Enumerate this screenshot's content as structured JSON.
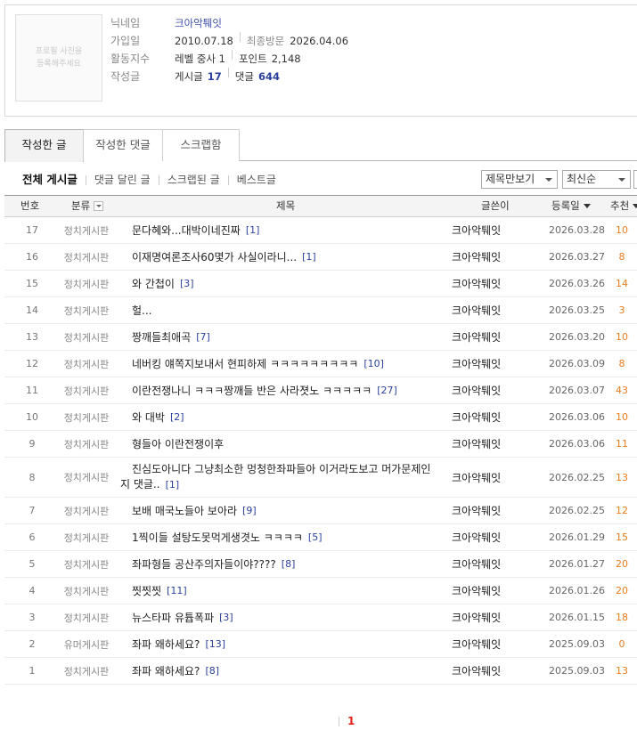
{
  "profile": {
    "photo_placeholder": "프로필 사진을\n등록해주세요",
    "nickname_label": "닉네임",
    "nickname": "크아악퉤잇",
    "joined_label": "가입일",
    "joined": "2010.07.18",
    "last_visit_label": "최종방문",
    "last_visit": "2026.04.06",
    "activity_label": "활동지수",
    "level": "레벨 중사 1",
    "point_label": "포인트",
    "point": "2,148",
    "posts_label": "작성글",
    "post_count_label": "게시글",
    "post_count": "17",
    "comment_count_label": "댓글",
    "comment_count": "644"
  },
  "tabs": [
    "작성한 글",
    "작성한 댓글",
    "스크랩함"
  ],
  "filters": [
    "전체 게시글",
    "댓글 달린 글",
    "스크랩된 글",
    "베스트글"
  ],
  "view_select": "제목만보기",
  "sort_select": "최신순",
  "table": {
    "headers": {
      "num": "번호",
      "cat": "분류",
      "title": "제목",
      "author": "글쓴이",
      "date": "등록일",
      "rec": "추천"
    },
    "rows": [
      {
        "num": "17",
        "cat": "정치게시판",
        "title": "문다혜와...대박이네진짜",
        "cc": "[1]",
        "author": "크아악퉤잇",
        "date": "2026.03.28",
        "rec": "10"
      },
      {
        "num": "16",
        "cat": "정치게시판",
        "title": "이재명여론조사60몇가 사실이라니...",
        "cc": "[1]",
        "author": "크아악퉤잇",
        "date": "2026.03.27",
        "rec": "8"
      },
      {
        "num": "15",
        "cat": "정치게시판",
        "title": "와 간첩이",
        "cc": "[3]",
        "author": "크아악퉤잇",
        "date": "2026.03.26",
        "rec": "14"
      },
      {
        "num": "14",
        "cat": "정치게시판",
        "title": "헐...",
        "cc": "",
        "author": "크아악퉤잇",
        "date": "2026.03.25",
        "rec": "3"
      },
      {
        "num": "13",
        "cat": "정치게시판",
        "title": "짱깨들최애곡",
        "cc": "[7]",
        "author": "크아악퉤잇",
        "date": "2026.03.20",
        "rec": "10"
      },
      {
        "num": "12",
        "cat": "정치게시판",
        "title": "네버킹 얘쪽지보내서 현피하제 ㅋㅋㅋㅋㅋㅋㅋㅋㅋ",
        "cc": "[10]",
        "author": "크아악퉤잇",
        "date": "2026.03.09",
        "rec": "8"
      },
      {
        "num": "11",
        "cat": "정치게시판",
        "title": "이란전쟁나니 ㅋㅋㅋ짱깨들 반은 사라졋노 ㅋㅋㅋㅋㅋ",
        "cc": "[27]",
        "author": "크아악퉤잇",
        "date": "2026.03.07",
        "rec": "43"
      },
      {
        "num": "10",
        "cat": "정치게시판",
        "title": "와 대박",
        "cc": "[2]",
        "author": "크아악퉤잇",
        "date": "2026.03.06",
        "rec": "10"
      },
      {
        "num": "9",
        "cat": "정치게시판",
        "title": "형들아 이란전쟁이후",
        "cc": "",
        "author": "크아악퉤잇",
        "date": "2026.03.06",
        "rec": "11"
      },
      {
        "num": "8",
        "cat": "정치게시판",
        "title": "진심도아니다 그냥최소한 멍청한좌파들아 이거라도보고 머가문제인지 댓글..",
        "cc": "[1]",
        "author": "크아악퉤잇",
        "date": "2026.02.25",
        "rec": "13",
        "tall": true
      },
      {
        "num": "7",
        "cat": "정치게시판",
        "title": "보배 매국노들아 보아라",
        "cc": "[9]",
        "author": "크아악퉤잇",
        "date": "2026.02.25",
        "rec": "12"
      },
      {
        "num": "6",
        "cat": "정치게시판",
        "title": "1찍이들 설탕도못먹게생겻노 ㅋㅋㅋㅋ",
        "cc": "[5]",
        "author": "크아악퉤잇",
        "date": "2026.01.29",
        "rec": "15"
      },
      {
        "num": "5",
        "cat": "정치게시판",
        "title": "좌파형들 공산주의자들이야????",
        "cc": "[8]",
        "author": "크아악퉤잇",
        "date": "2026.01.27",
        "rec": "20"
      },
      {
        "num": "4",
        "cat": "정치게시판",
        "title": "찟찟찟",
        "cc": "[11]",
        "author": "크아악퉤잇",
        "date": "2026.01.26",
        "rec": "20"
      },
      {
        "num": "3",
        "cat": "정치게시판",
        "title": "뉴스타파 유튭폭파",
        "cc": "[3]",
        "author": "크아악퉤잇",
        "date": "2026.01.15",
        "rec": "18"
      },
      {
        "num": "2",
        "cat": "유머게시판",
        "title": "좌파 왜하세요?",
        "cc": "[13]",
        "author": "크아악퉤잇",
        "date": "2025.09.03",
        "rec": "0"
      },
      {
        "num": "1",
        "cat": "정치게시판",
        "title": "좌파 왜하세요?",
        "cc": "[8]",
        "author": "크아악퉤잇",
        "date": "2025.09.03",
        "rec": "13"
      }
    ]
  },
  "pagination": {
    "current": "1"
  },
  "colors": {
    "nickname": "#3b4fa8",
    "count": "#2a3f9d",
    "recommend": "#e87d1e",
    "current_page": "#e2231a"
  }
}
